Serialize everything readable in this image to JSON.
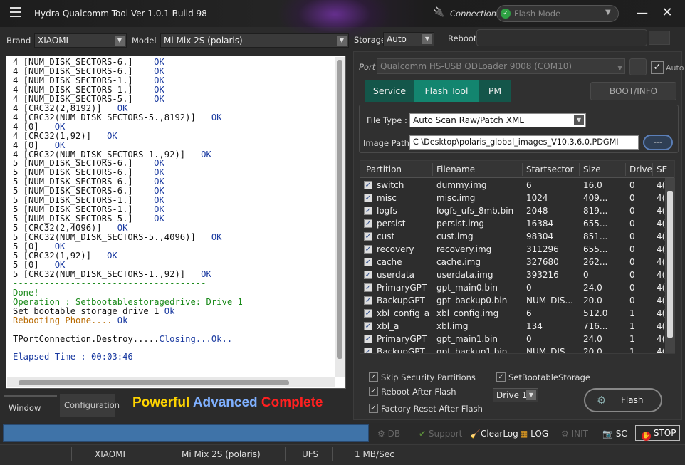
{
  "window": {
    "title": "Hydra Qualcomm  Tool  Ver 1.0.1 Build 98",
    "connection_label": "Connection",
    "connection_value": "Flash Mode"
  },
  "device": {
    "brand_label": "Brand :",
    "brand": "XIAOMI",
    "model_label": "Model :",
    "model": "Mi Mix 2S (polaris)",
    "storage_label": "Storage",
    "storage": "Auto",
    "reboot_label": "Reboot"
  },
  "log": {
    "lines": [
      {
        "t": "4 [NUM_DISK_SECTORS-6.]    ",
        "s": "OK",
        "c": ""
      },
      {
        "t": "4 [NUM_DISK_SECTORS-6.]    ",
        "s": "OK",
        "c": ""
      },
      {
        "t": "4 [NUM_DISK_SECTORS-1.]    ",
        "s": "OK",
        "c": ""
      },
      {
        "t": "4 [NUM_DISK_SECTORS-1.]    ",
        "s": "OK",
        "c": ""
      },
      {
        "t": "4 [NUM_DISK_SECTORS-5.]    ",
        "s": "OK",
        "c": ""
      },
      {
        "t": "4 [CRC32(2,8192)]   ",
        "s": "OK",
        "c": ""
      },
      {
        "t": "4 [CRC32(NUM_DISK_SECTORS-5.,8192)]   ",
        "s": "OK",
        "c": ""
      },
      {
        "t": "4 [0]   ",
        "s": "OK",
        "c": ""
      },
      {
        "t": "4 [CRC32(1,92)]   ",
        "s": "OK",
        "c": ""
      },
      {
        "t": "4 [0]   ",
        "s": "OK",
        "c": ""
      },
      {
        "t": "4 [CRC32(NUM_DISK_SECTORS-1.,92)]   ",
        "s": "OK",
        "c": ""
      },
      {
        "t": "5 [NUM_DISK_SECTORS-6.]    ",
        "s": "OK",
        "c": ""
      },
      {
        "t": "5 [NUM_DISK_SECTORS-6.]    ",
        "s": "OK",
        "c": ""
      },
      {
        "t": "5 [NUM_DISK_SECTORS-6.]    ",
        "s": "OK",
        "c": ""
      },
      {
        "t": "5 [NUM_DISK_SECTORS-6.]    ",
        "s": "OK",
        "c": ""
      },
      {
        "t": "5 [NUM_DISK_SECTORS-1.]    ",
        "s": "OK",
        "c": ""
      },
      {
        "t": "5 [NUM_DISK_SECTORS-1.]    ",
        "s": "OK",
        "c": ""
      },
      {
        "t": "5 [NUM_DISK_SECTORS-5.]    ",
        "s": "OK",
        "c": ""
      },
      {
        "t": "5 [CRC32(2,4096)]   ",
        "s": "OK",
        "c": ""
      },
      {
        "t": "5 [CRC32(NUM_DISK_SECTORS-5.,4096)]   ",
        "s": "OK",
        "c": ""
      },
      {
        "t": "5 [0]   ",
        "s": "OK",
        "c": ""
      },
      {
        "t": "5 [CRC32(1,92)]   ",
        "s": "OK",
        "c": ""
      },
      {
        "t": "5 [0]   ",
        "s": "OK",
        "c": ""
      },
      {
        "t": "5 [CRC32(NUM_DISK_SECTORS-1.,92)]   ",
        "s": "OK",
        "c": ""
      },
      {
        "t": "-------------------------------------",
        "s": "",
        "c": "grn"
      },
      {
        "t": "Done!",
        "s": "",
        "c": "grn"
      },
      {
        "t": "Operation : Setbootablestoragedrive: Drive 1",
        "s": "",
        "c": "grn"
      },
      {
        "t": "Set bootable storage drive 1 ",
        "s": "Ok",
        "c": ""
      },
      {
        "t": "Rebooting Phone.... ",
        "s": "Ok",
        "c": "org"
      },
      {
        "t": "",
        "s": "",
        "c": ""
      },
      {
        "t": "TPortConnection.Destroy.....",
        "s": "Closing...Ok..",
        "c": "",
        "sc": "blu"
      },
      {
        "t": "",
        "s": "",
        "c": ""
      },
      {
        "t": "Elapsed Time : 00:03:46",
        "s": "",
        "c": "blu"
      }
    ]
  },
  "tabs_bottom": {
    "window_log": "Window Log",
    "configuration": "Configuration"
  },
  "slogan": {
    "w1": "Powerful",
    "w2": "Advanced",
    "w3": "Complete"
  },
  "port": {
    "label": "Port",
    "value": "Qualcomm HS-USB QDLoader 9008 (COM10)",
    "auto_label": "Auto"
  },
  "tabs": {
    "service": "Service",
    "flash_tool": "Flash Tool",
    "pm": "PM",
    "boot_info": "BOOT/INFO"
  },
  "flash": {
    "filetype_label": "File Type :",
    "filetype": "Auto Scan Raw/Patch XML",
    "imagepath_label": "Image Path:",
    "imagepath": "C                       \\Desktop\\polaris_global_images_V10.3.6.0.PDGMI",
    "browse": "---"
  },
  "partition_table": {
    "headers": [
      "Partition",
      "Filename",
      "Startsector",
      "Size",
      "Drive",
      "SE"
    ],
    "rows": [
      [
        "switch",
        "dummy.img",
        "6",
        "16.0",
        "0",
        "4("
      ],
      [
        "misc",
        "misc.img",
        "1024",
        "409...",
        "0",
        "4("
      ],
      [
        "logfs",
        "logfs_ufs_8mb.bin",
        "2048",
        "819...",
        "0",
        "4("
      ],
      [
        "persist",
        "persist.img",
        "16384",
        "655...",
        "0",
        "4("
      ],
      [
        "cust",
        "cust.img",
        "98304",
        "851...",
        "0",
        "4("
      ],
      [
        "recovery",
        "recovery.img",
        "311296",
        "655...",
        "0",
        "4("
      ],
      [
        "cache",
        "cache.img",
        "327680",
        "262...",
        "0",
        "4("
      ],
      [
        "userdata",
        "userdata.img",
        "393216",
        "0",
        "0",
        "4("
      ],
      [
        "PrimaryGPT",
        "gpt_main0.bin",
        "0",
        "24.0",
        "0",
        "4("
      ],
      [
        "BackupGPT",
        "gpt_backup0.bin",
        "NUM_DIS...",
        "20.0",
        "0",
        "4("
      ],
      [
        "xbl_config_a",
        "xbl_config.img",
        "6",
        "512.0",
        "1",
        "4("
      ],
      [
        "xbl_a",
        "xbl.img",
        "134",
        "716...",
        "1",
        "4("
      ],
      [
        "PrimaryGPT",
        "gpt_main1.bin",
        "0",
        "24.0",
        "1",
        "4("
      ],
      [
        "BackupGPT",
        "gpt_backup1.bin",
        "NUM_DIS...",
        "20.0",
        "1",
        "4("
      ]
    ]
  },
  "options": {
    "skip_security": "Skip Security Partitions",
    "set_bootable": "SetBootableStorage",
    "reboot_after": "Reboot After Flash",
    "factory_reset": "Factory Reset After Flash",
    "drive": "Drive 1",
    "flash_button": "Flash"
  },
  "toolbar": {
    "db": "DB",
    "support": "Support",
    "clearlog": "ClearLog",
    "log": "LOG",
    "init": "INIT",
    "sc": "SC",
    "stop": "STOP"
  },
  "status": {
    "brand": "XIAOMI",
    "model": "Mi Mix 2S (polaris)",
    "storage": "UFS",
    "speed": "1 MB/Sec"
  },
  "colors": {
    "accent_tab": "#13856f",
    "tab_dark": "#14564a",
    "progress": "#3f73a8",
    "slogan_yellow": "#ffd400",
    "slogan_blue": "#7fb0ff",
    "slogan_red": "#ff2020"
  }
}
